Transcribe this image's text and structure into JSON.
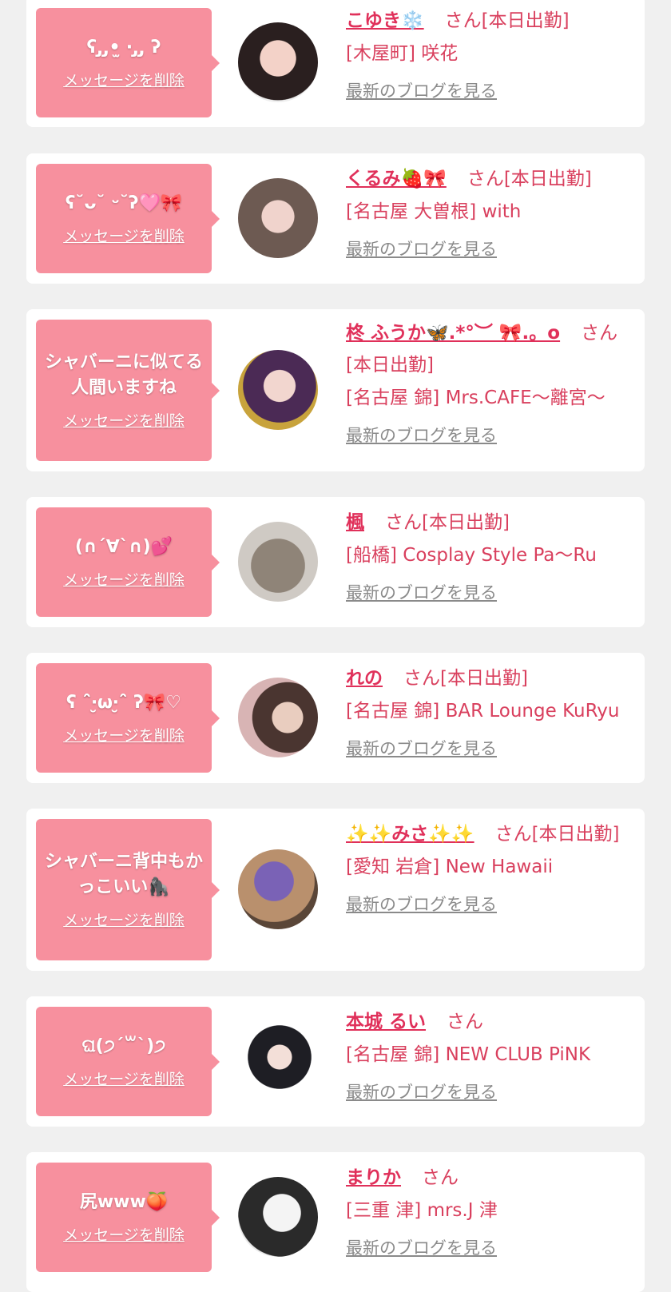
{
  "delete_label": "メッセージを削除",
  "blog_label": "最新のブログを見る",
  "suffix": "さん[本日出勤]",
  "suffix_short": "さん",
  "colors": {
    "background": "#f0f0f0",
    "bubble": "#f7909e",
    "name": "#e0305a",
    "text": "#d9405e",
    "link_gray": "#8a8a8a"
  },
  "items": [
    {
      "message": "ʕ ̡  ̡•̫ ‧ ̡ ̡ ʔ",
      "name": "こゆき❄️",
      "suffix_key": "full",
      "shop": "[木屋町] 咲花"
    },
    {
      "message": "ʕ˘ᴗ˘ ᵕ˘ʔ🩷🎀",
      "name": "くるみ🍓🎀",
      "suffix_key": "full",
      "shop": "[名古屋 大曽根] with"
    },
    {
      "message": "シャバーニに似てる人間いますね",
      "name": "柊 ふうか🦋.*°︶ 🎀.。o",
      "suffix_key": "full",
      "shop": "[名古屋 錦] Mrs.CAFE〜離宮〜"
    },
    {
      "message": "(∩´∀`∩)💕",
      "name": "楓",
      "suffix_key": "full",
      "shop": "[船橋] Cosplay Style Pa〜Ru"
    },
    {
      "message": "ʕ ˆ̑‧̮ω‧̮ˆ̑ ʔ🎀♡",
      "name": "れの",
      "suffix_key": "full",
      "shop": "[名古屋 錦] BAR Lounge KuRyu"
    },
    {
      "message": "シャバーニ背中もかっこいい🦍",
      "name": "✨✨みさ✨✨",
      "suffix_key": "full",
      "shop": "[愛知 岩倉] New Hawaii"
    },
    {
      "message": "ଘ(੭ˊ꒳ˋ)੭",
      "name": "本城 るい",
      "suffix_key": "short",
      "shop": "[名古屋 錦] NEW CLUB PiNK"
    },
    {
      "message": "尻www🍑",
      "name": "まりか",
      "suffix_key": "short",
      "shop": "[三重 津] mrs.J 津"
    }
  ]
}
